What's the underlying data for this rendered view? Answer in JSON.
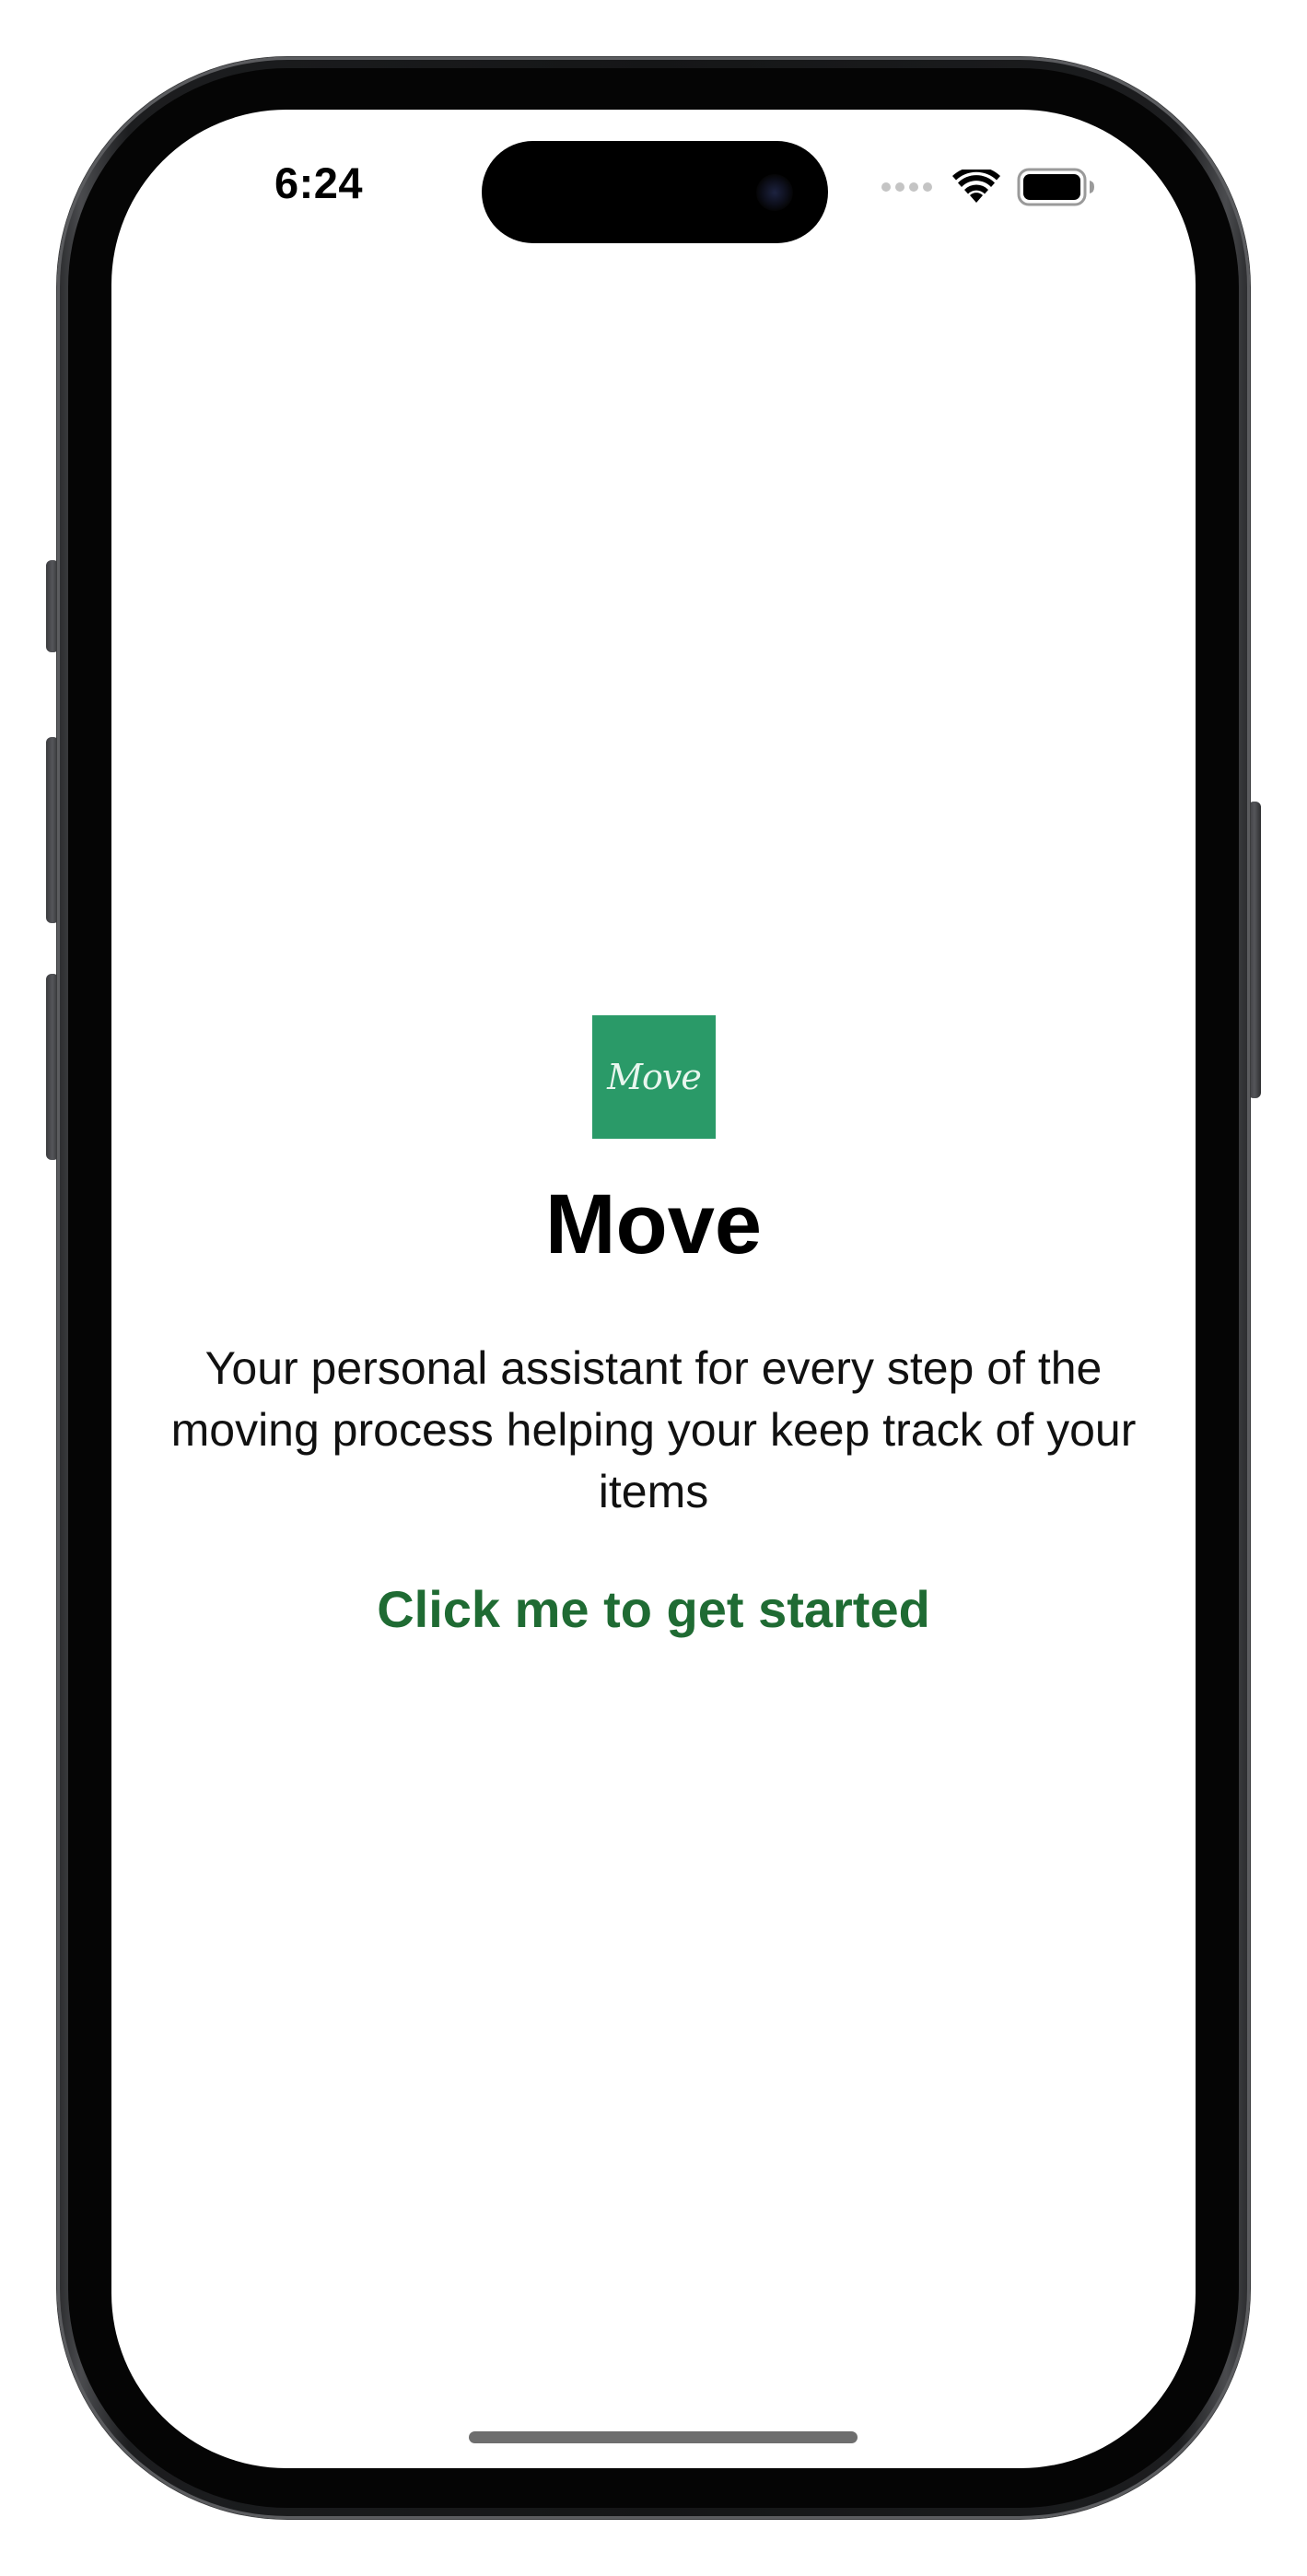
{
  "status_bar": {
    "time": "6:24",
    "signal_icon": "signal-dots-icon",
    "wifi_icon": "wifi-icon",
    "battery_icon": "battery-icon",
    "battery_level": 1.0
  },
  "app": {
    "logo_text": "Move",
    "logo_color": "#2a9a68",
    "title": "Move",
    "description": "Your personal assistant for every step of the moving process helping your keep track of your items",
    "cta_label": "Click me to get started",
    "cta_color": "#1f6b33"
  }
}
